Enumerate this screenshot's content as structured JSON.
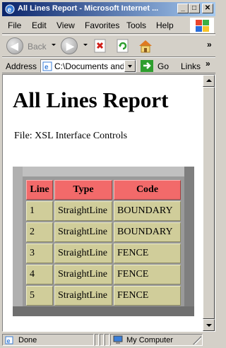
{
  "window": {
    "title": "All Lines Report - Microsoft Internet ...",
    "minimize_glyph": "_",
    "maximize_glyph": "□",
    "close_glyph": "✕"
  },
  "menu": {
    "items": [
      "File",
      "Edit",
      "View",
      "Favorites",
      "Tools",
      "Help"
    ]
  },
  "toolbar": {
    "back_label": "Back",
    "icons": [
      "back-arrow-icon",
      "forward-arrow-icon",
      "stop-icon",
      "refresh-icon",
      "home-icon"
    ]
  },
  "address": {
    "label": "Address",
    "value": "C:\\Documents and",
    "go_label": "Go",
    "links_label": "Links",
    "chevron": "»"
  },
  "page": {
    "title": "All Lines Report",
    "file_line": "File: XSL Interface Controls"
  },
  "table": {
    "headers": [
      "Line",
      "Type",
      "Code"
    ],
    "rows": [
      [
        "1",
        "StraightLine",
        "BOUNDARY"
      ],
      [
        "2",
        "StraightLine",
        "BOUNDARY"
      ],
      [
        "3",
        "StraightLine",
        "FENCE"
      ],
      [
        "4",
        "StraightLine",
        "FENCE"
      ],
      [
        "5",
        "StraightLine",
        "FENCE"
      ]
    ],
    "header_color": "#f26a6a",
    "cell_color": "#d0cd9a"
  },
  "status": {
    "text": "Done",
    "zone": "My Computer"
  }
}
